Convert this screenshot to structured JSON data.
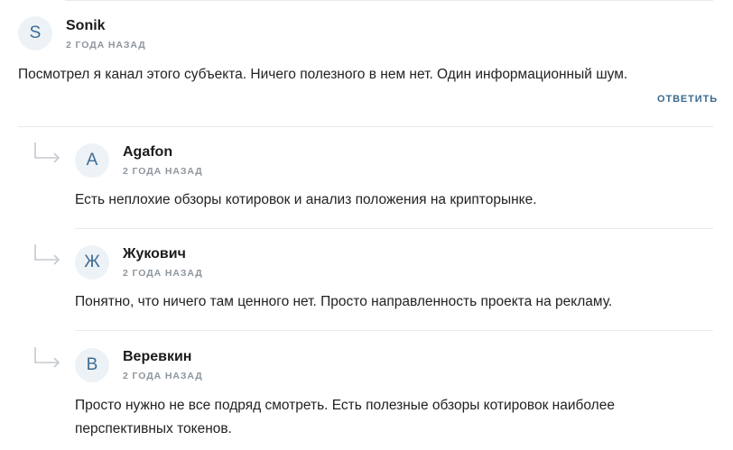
{
  "comments": [
    {
      "avatar_letter": "S",
      "author": "Sonik",
      "time": "2 ГОДА НАЗАД",
      "text": "Посмотрел я канал этого субъекта. Ничего полезного в нем нет. Один информационный шум.",
      "reply_label": "ОТВЕТИТЬ"
    }
  ],
  "replies": [
    {
      "avatar_letter": "A",
      "author": "Agafon",
      "time": "2 ГОДА НАЗАД",
      "text": "Есть неплохие обзоры котировок и анализ положения на крипторынке."
    },
    {
      "avatar_letter": "Ж",
      "author": "Жукович",
      "time": "2 ГОДА НАЗАД",
      "text": "Понятно, что ничего там ценного нет. Просто направленность проекта на рекламу."
    },
    {
      "avatar_letter": "В",
      "author": "Веревкин",
      "time": "2 ГОДА НАЗАД",
      "text": "Просто нужно не все подряд смотреть. Есть полезные обзоры котировок наиболее перспективных токенов."
    }
  ]
}
